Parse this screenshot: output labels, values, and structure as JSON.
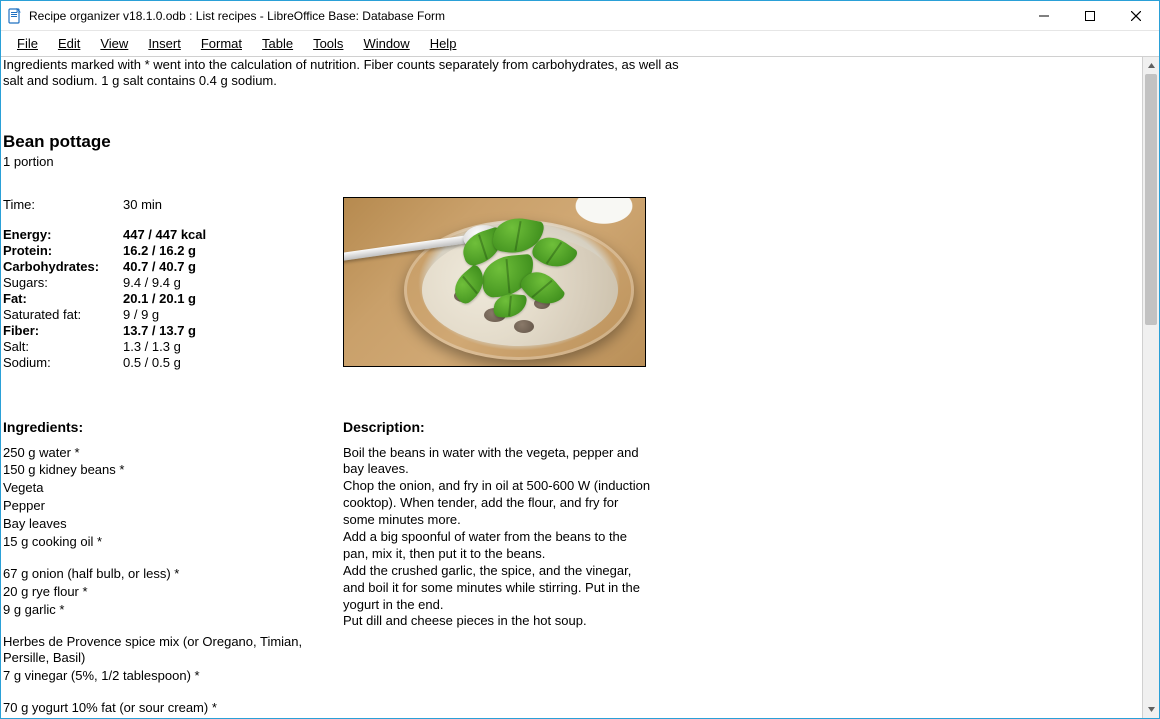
{
  "window": {
    "title": "Recipe organizer v18.1.0.odb : List recipes - LibreOffice Base: Database Form"
  },
  "menu": {
    "file": "File",
    "edit": "Edit",
    "view": "View",
    "insert": "Insert",
    "format": "Format",
    "table": "Table",
    "tools": "Tools",
    "window": "Window",
    "help": "Help"
  },
  "note_line1": "Ingredients marked with * went into the calculation of nutrition. Fiber counts separately from carbohydrates, as well as",
  "note_line2": "salt and sodium. 1 g salt contains 0.4 g sodium.",
  "recipe": {
    "title": "Bean pottage",
    "portion": "1 portion",
    "time_label": "Time:",
    "time_value": "30 min"
  },
  "nutrition": [
    {
      "label": "Energy:",
      "value": "447 / 447 kcal",
      "bold": true
    },
    {
      "label": "Protein:",
      "value": "16.2 / 16.2 g",
      "bold": true
    },
    {
      "label": "Carbohydrates:",
      "value": "40.7 / 40.7 g",
      "bold": true
    },
    {
      "label": "Sugars:",
      "value": "9.4 / 9.4 g",
      "bold": false
    },
    {
      "label": "Fat:",
      "value": "20.1 / 20.1 g",
      "bold": true
    },
    {
      "label": "Saturated fat:",
      "value": "9 / 9 g",
      "bold": false
    },
    {
      "label": "Fiber:",
      "value": "13.7 / 13.7 g",
      "bold": true
    },
    {
      "label": "Salt:",
      "value": "1.3 / 1.3 g",
      "bold": false
    },
    {
      "label": "Sodium:",
      "value": "0.5 / 0.5 g",
      "bold": false
    }
  ],
  "headings": {
    "ingredients": "Ingredients:",
    "description": "Description:"
  },
  "ingredients_block1": [
    "250 g water *",
    "150 g kidney beans *",
    "Vegeta",
    "Pepper",
    "Bay leaves",
    "15 g cooking oil *"
  ],
  "ingredients_block2": [
    "67 g onion (half bulb, or less) *",
    "20 g rye flour *",
    "9 g garlic *"
  ],
  "ingredients_block3": [
    "Herbes de Provence spice mix (or Oregano, Timian, Persille, Basil)",
    "7 g vinegar (5%, 1/2 tablespoon) *"
  ],
  "ingredients_block4": [
    "70 g yogurt 10% fat (or sour cream) *"
  ],
  "description_lines": [
    "Boil the beans in water with the vegeta, pepper and bay leaves.",
    "Chop the onion, and fry in oil at 500-600 W (induction cooktop). When tender, add the flour, and fry for some minutes more.",
    "Add a big spoonful of water from the beans to the pan, mix it, then put it to the beans.",
    "Add the crushed garlic, the spice, and the vinegar, and boil it for some minutes while stirring. Put in the yogurt in the end.",
    "Put dill and cheese pieces in the hot soup."
  ]
}
